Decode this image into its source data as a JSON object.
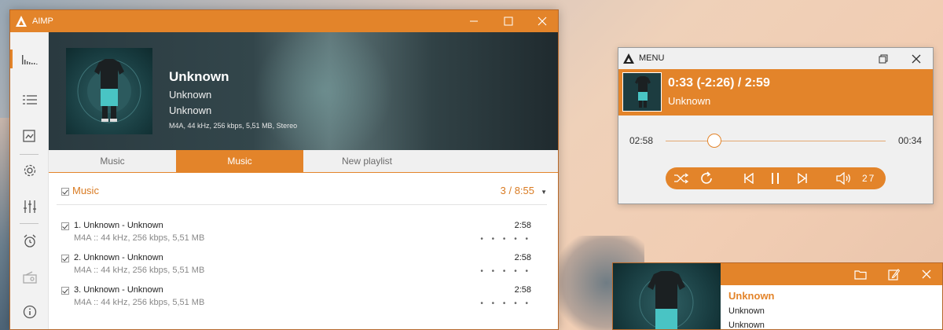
{
  "main_window": {
    "title": "AIMP",
    "now_playing": {
      "title": "Unknown",
      "artist": "Unknown",
      "album": "Unknown",
      "info": "M4A, 44 kHz, 256 kbps, 5,51 MB, Stereo"
    },
    "tabs": [
      {
        "label": "Music",
        "active": false
      },
      {
        "label": "Music",
        "active": true
      },
      {
        "label": "New playlist",
        "active": false
      }
    ],
    "playlist": {
      "group_title": "Music",
      "group_stats": "3 / 8:55",
      "tracks": [
        {
          "title": "1. Unknown - Unknown",
          "meta": "M4A :: 44 kHz, 256 kbps, 5,51 MB",
          "duration": "2:58",
          "rating": "• • • • •"
        },
        {
          "title": "2. Unknown - Unknown",
          "meta": "M4A :: 44 kHz, 256 kbps, 5,51 MB",
          "duration": "2:58",
          "rating": "• • • • •"
        },
        {
          "title": "3. Unknown - Unknown",
          "meta": "M4A :: 44 kHz, 256 kbps, 5,51 MB",
          "duration": "2:58",
          "rating": "• • • • •"
        }
      ]
    },
    "sidebar_icons": [
      "visualization-icon",
      "playlist-icon",
      "library-icon",
      "settings-icon",
      "equalizer-icon",
      "alarm-icon",
      "radio-icon",
      "info-icon"
    ]
  },
  "mini_player": {
    "title": "MENU",
    "time": "0:33 (-2:26) / 2:59",
    "artist": "Unknown",
    "elapsed": "02:58",
    "remaining": "00:34",
    "seek_fraction": 0.22,
    "volume": "27"
  },
  "float_player": {
    "title": "Unknown",
    "line1": "Unknown",
    "line2": "Unknown"
  },
  "colors": {
    "accent": "#e3842a",
    "accent_dark": "#d97b22"
  }
}
